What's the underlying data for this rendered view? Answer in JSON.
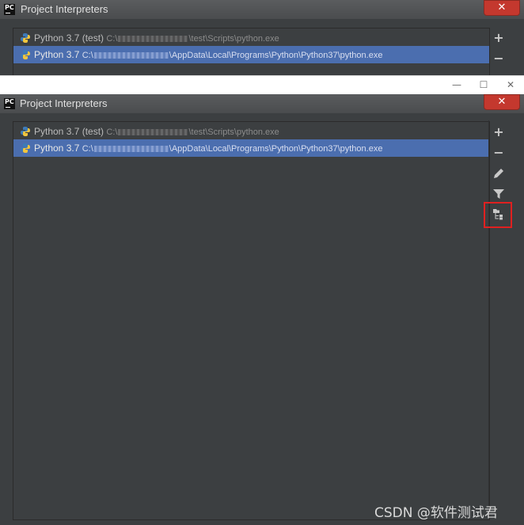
{
  "dialog_back": {
    "title": "Project Interpreters",
    "close_label": "✕",
    "interpreters": [
      {
        "name": "Python 3.7 (test)",
        "path_prefix": "C:\\",
        "path_suffix": "\\test\\Scripts\\python.exe",
        "selected": false
      },
      {
        "name": "Python 3.7",
        "path_prefix": "C:\\",
        "path_suffix": "\\AppData\\Local\\Programs\\Python\\Python37\\python.exe",
        "selected": true
      }
    ],
    "toolbar": {
      "add": "+",
      "remove": "−"
    }
  },
  "host_window": {
    "minimize": "—",
    "maximize": "☐",
    "close": "✕"
  },
  "dialog_front": {
    "title": "Project Interpreters",
    "close_label": "✕",
    "interpreters": [
      {
        "name": "Python 3.7 (test)",
        "path_prefix": "C:\\",
        "path_suffix": "\\test\\Scripts\\python.exe",
        "selected": false
      },
      {
        "name": "Python 3.7",
        "path_prefix": "C:\\",
        "path_suffix": "\\AppData\\Local\\Programs\\Python\\Python37\\python.exe",
        "selected": true
      }
    ],
    "toolbar": {
      "add": "+",
      "remove": "−",
      "edit_icon": "pencil-icon",
      "filter_icon": "filter-icon",
      "paths_icon": "folder-tree-icon"
    }
  },
  "colors": {
    "accent_selection": "#4b6eaf",
    "highlight_box": "#e02020",
    "background": "#3c3f41"
  },
  "watermark": "CSDN @软件测试君"
}
